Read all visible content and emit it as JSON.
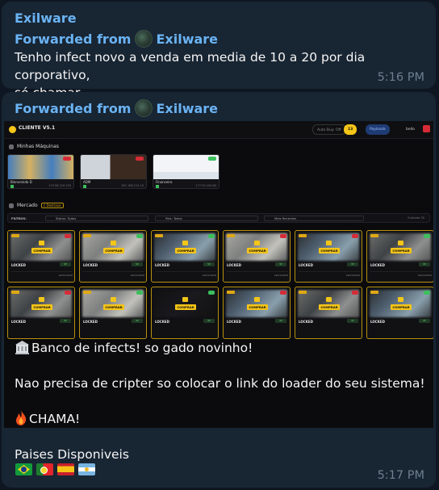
{
  "message1": {
    "sender": "Exilware",
    "forwarded_prefix": "Forwarded from",
    "forwarded_from": "Exilware",
    "text_line1": "Tenho infect novo a venda em media de 10 a 20 por dia corporativo,",
    "text_line2": "só chamar",
    "time": "5:16 PM"
  },
  "message2": {
    "forwarded_prefix": "Forwarded from",
    "forwarded_from": "Exilware",
    "line1": "Banco de infects! so gado novinho!",
    "line2": "Nao precisa de cripter so colocar o link do loader do seu sistema!",
    "line3": "CHAMA!",
    "line4": "Paises Disponiveis",
    "flags": [
      "brazil-flag",
      "portugal-flag",
      "spain-flag",
      "argentina-flag"
    ],
    "time": "5:17 PM"
  },
  "dashboard": {
    "title": "CLIENTE V5.1",
    "auto_buy": "Auto Buy: Off",
    "balance": "13",
    "payloads": "Payloads",
    "user": "bello",
    "my_machines_title": "Minhas Máquinas",
    "machines": [
      {
        "name": "Bienvenido D",
        "ip": "179.58.220.130"
      },
      {
        "name": "ADM",
        "ip": "187.108.212.19"
      },
      {
        "name": "Financeiro",
        "ip": "177.20.150.80"
      }
    ],
    "market_title": "Mercado",
    "market_badge": "1 Destrava",
    "filters_label": "FILTROS:",
    "filter_status": "Status: Todos",
    "filter_country": "País: Todos",
    "filter_sort": "Mais Recentes",
    "results": "Exibindo 35",
    "cards": [
      {
        "new_label": "NOVO",
        "buy_label": "COMPRAR",
        "locked_label": "LOCKED",
        "price": "$5",
        "date": "24/01/2026"
      },
      {
        "new_label": "NOVO",
        "buy_label": "COMPRAR",
        "locked_label": "LOCKED",
        "price": "$5",
        "date": "24/01/2026"
      },
      {
        "new_label": "NOVO",
        "buy_label": "COMPRAR",
        "locked_label": "LOCKED",
        "price": "$5",
        "date": "24/01/2026"
      },
      {
        "new_label": "NOVO",
        "buy_label": "COMPRAR",
        "locked_label": "LOCKED",
        "price": "$5",
        "date": "24/01/2026"
      },
      {
        "new_label": "NOVO",
        "buy_label": "COMPRAR",
        "locked_label": "LOCKED",
        "price": "$5",
        "date": "24/01/2026"
      },
      {
        "new_label": "NOVO",
        "buy_label": "COMPRAR",
        "locked_label": "LOCKED",
        "price": "$5",
        "date": "24/01/2026"
      },
      {
        "new_label": "NOVO",
        "buy_label": "COMPRAR",
        "locked_label": "LOCKED",
        "price": "$5",
        "date": ""
      },
      {
        "new_label": "NOVO",
        "buy_label": "COMPRAR",
        "locked_label": "LOCKED",
        "price": "$5",
        "date": ""
      },
      {
        "new_label": "",
        "buy_label": "COMPRAR",
        "locked_label": "LOCKED",
        "price": "$5",
        "date": ""
      },
      {
        "new_label": "NOVO",
        "buy_label": "COMPRAR",
        "locked_label": "LOCKED",
        "price": "$5",
        "date": ""
      },
      {
        "new_label": "NOVO",
        "buy_label": "COMPRAR",
        "locked_label": "LOCKED",
        "price": "$5",
        "date": ""
      },
      {
        "new_label": "NOVO",
        "buy_label": "COMPRAR",
        "locked_label": "LOCKED",
        "price": "$5",
        "date": ""
      }
    ]
  },
  "colors": {
    "background": "#0e1621",
    "bubble": "#182533",
    "link": "#6ab3f3",
    "time": "#6d7f8f",
    "accent_gold": "#f5c518"
  }
}
